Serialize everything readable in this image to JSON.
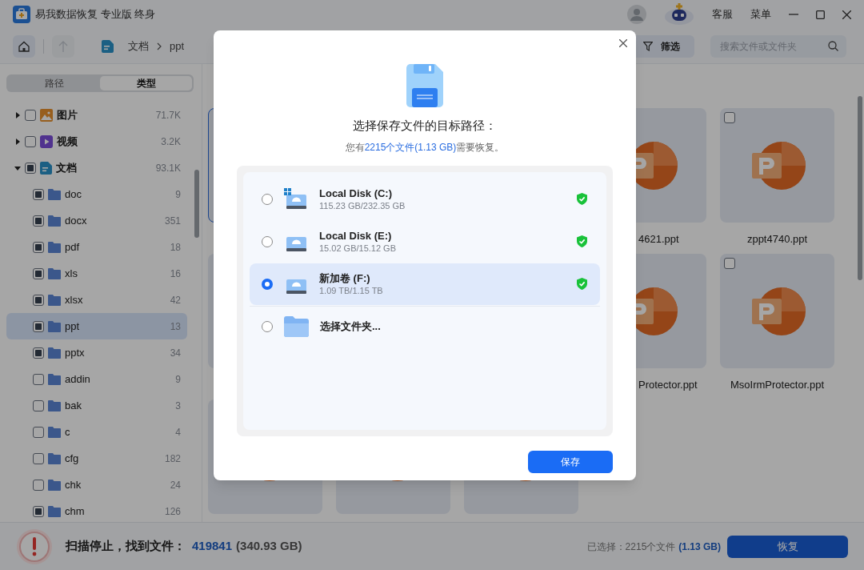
{
  "window": {
    "title": "易我数据恢复 专业版 终身",
    "links": [
      "客服",
      "菜单"
    ]
  },
  "toolbar": {
    "breadcrumb": [
      "文档",
      "ppt"
    ],
    "filter_label": "筛选",
    "search": {
      "placeholder": "搜索文件或文件夹"
    }
  },
  "sidebar": {
    "tabs": [
      {
        "label": "路径",
        "selected": false
      },
      {
        "label": "类型",
        "selected": true
      }
    ],
    "tree": [
      {
        "label": "图片",
        "count": "71.7K",
        "kind": "image",
        "checked": false,
        "expanded": false,
        "selected": false
      },
      {
        "label": "视频",
        "count": "3.2K",
        "kind": "video",
        "checked": false,
        "expanded": false,
        "selected": false
      },
      {
        "label": "文档",
        "count": "93.1K",
        "kind": "doc",
        "checked": true,
        "expanded": true,
        "selected": false,
        "children": [
          {
            "label": "doc",
            "count": "9",
            "kind": "folder",
            "checked": true,
            "selected": false
          },
          {
            "label": "docx",
            "count": "351",
            "kind": "folder",
            "checked": true,
            "selected": false
          },
          {
            "label": "pdf",
            "count": "18",
            "kind": "folder",
            "checked": true,
            "selected": false
          },
          {
            "label": "xls",
            "count": "16",
            "kind": "folder",
            "checked": true,
            "selected": false
          },
          {
            "label": "xlsx",
            "count": "42",
            "kind": "folder",
            "checked": true,
            "selected": false
          },
          {
            "label": "ppt",
            "count": "13",
            "kind": "folder",
            "checked": true,
            "selected": true
          },
          {
            "label": "pptx",
            "count": "34",
            "kind": "folder",
            "checked": true,
            "selected": false
          },
          {
            "label": "addin",
            "count": "9",
            "kind": "folder",
            "checked": false,
            "selected": false
          },
          {
            "label": "bak",
            "count": "3",
            "kind": "folder",
            "checked": false,
            "selected": false
          },
          {
            "label": "c",
            "count": "4",
            "kind": "folder",
            "checked": false,
            "selected": false
          },
          {
            "label": "cfg",
            "count": "182",
            "kind": "folder",
            "checked": false,
            "selected": false
          },
          {
            "label": "chk",
            "count": "24",
            "kind": "folder",
            "checked": false,
            "selected": false
          },
          {
            "label": "chm",
            "count": "126",
            "kind": "folder",
            "checked": true,
            "selected": false
          }
        ]
      }
    ]
  },
  "files": [
    {
      "selected": true
    },
    {
      "kind": "ppt",
      "name": "4621.ppt"
    },
    {
      "kind": "ppt",
      "checked": false,
      "name": "zppt4740.ppt"
    },
    {
      "selected": false
    },
    {
      "kind": "ppt",
      "name": "Protector.ppt"
    },
    {
      "kind": "ppt",
      "checked": false,
      "name": "MsoIrmProtector.ppt"
    },
    {
      "kind": "ppt"
    },
    {
      "kind": "ppt"
    },
    {
      "kind": "ppt"
    }
  ],
  "status_bar": {
    "scan_label": "扫描停止，找到文件：",
    "found_count": "419841",
    "found_size": "(340.93 GB)",
    "selected_prefix": "已选择：2215个文件",
    "selected_size": "(1.13 GB)",
    "recover_button": "恢复"
  },
  "dialog": {
    "title": "选择保存文件的目标路径：",
    "summary_prefix": "您有",
    "summary_highlight": "2215个文件(1.13 GB)",
    "summary_suffix": "需要恢复。",
    "destinations": [
      {
        "kind": "disk",
        "system": true,
        "name": "Local Disk (C:)",
        "usage": "115.23 GB/232.35 GB",
        "selected": false
      },
      {
        "kind": "disk",
        "system": false,
        "name": "Local Disk (E:)",
        "usage": "15.02 GB/15.12 GB",
        "selected": false
      },
      {
        "kind": "disk",
        "system": false,
        "name": "新加卷 (F:)",
        "usage": "1.09 TB/1.15 TB",
        "selected": true
      },
      {
        "kind": "folder",
        "name": "选择文件夹...",
        "selected": false
      }
    ],
    "save_button": "保存"
  }
}
